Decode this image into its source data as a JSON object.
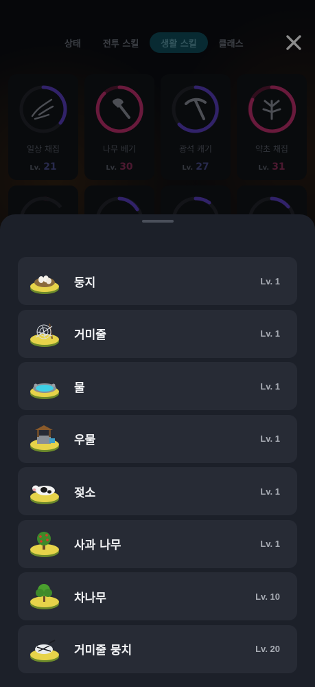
{
  "tabs": [
    {
      "label": "상태",
      "active": false
    },
    {
      "label": "전투 스킬",
      "active": false
    },
    {
      "label": "생활 스킬",
      "active": true
    },
    {
      "label": "클래스",
      "active": false
    }
  ],
  "close_icon": "close-icon",
  "skills": [
    {
      "name": "일상 채집",
      "lv_prefix": "Lv.",
      "level": "21",
      "icon": "hand-icon",
      "ring_color": "#5a3fc0"
    },
    {
      "name": "나무 베기",
      "lv_prefix": "Lv.",
      "level": "30",
      "icon": "axe-icon",
      "ring_color": "#c0306e"
    },
    {
      "name": "광석 캐기",
      "lv_prefix": "Lv.",
      "level": "27",
      "icon": "pickaxe-icon",
      "ring_color": "#5a3fc0"
    },
    {
      "name": "약초 채집",
      "lv_prefix": "Lv.",
      "level": "31",
      "icon": "herb-icon",
      "ring_color": "#c0306e"
    }
  ],
  "list": [
    {
      "name": "둥지",
      "level": "Lv. 1",
      "icon": "nest-icon"
    },
    {
      "name": "거미줄",
      "level": "Lv. 1",
      "icon": "spiderweb-icon"
    },
    {
      "name": "물",
      "level": "Lv. 1",
      "icon": "water-icon"
    },
    {
      "name": "우물",
      "level": "Lv. 1",
      "icon": "well-icon"
    },
    {
      "name": "젖소",
      "level": "Lv. 1",
      "icon": "cow-icon"
    },
    {
      "name": "사과 나무",
      "level": "Lv. 1",
      "icon": "apple-tree-icon"
    },
    {
      "name": "차나무",
      "level": "Lv. 10",
      "icon": "tea-tree-icon"
    },
    {
      "name": "거미줄 뭉치",
      "level": "Lv. 20",
      "icon": "web-bundle-icon"
    }
  ],
  "colors": {
    "accent_tab": "#0f4d5c",
    "sheet_bg": "#1c2029",
    "item_bg": "#272b35"
  }
}
